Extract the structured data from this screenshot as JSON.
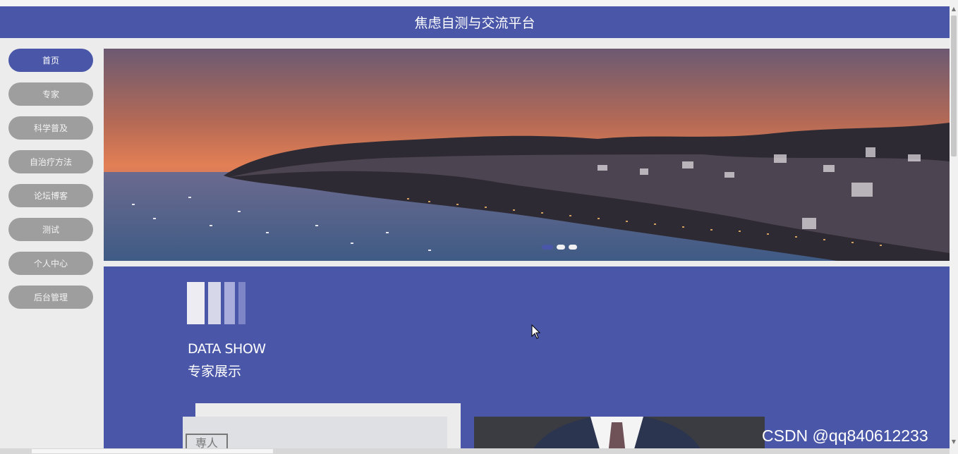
{
  "header": {
    "title": "焦虑自测与交流平台"
  },
  "nav": {
    "items": [
      {
        "label": "首页",
        "active": true
      },
      {
        "label": "专家",
        "active": false
      },
      {
        "label": "科学普及",
        "active": false
      },
      {
        "label": "自治疗方法",
        "active": false
      },
      {
        "label": "论坛博客",
        "active": false
      },
      {
        "label": "测试",
        "active": false
      },
      {
        "label": "个人中心",
        "active": false
      },
      {
        "label": "后台管理",
        "active": false
      }
    ]
  },
  "banner": {
    "slide_count": 3,
    "active_slide": 1
  },
  "section": {
    "title": "DATA SHOW",
    "subtitle": "专家展示",
    "card_icon_text": "専人"
  },
  "watermark": "CSDN @qq840612233",
  "colors": {
    "primary": "#4a57a8",
    "nav_inactive": "#9e9e9e",
    "background": "#ececec"
  }
}
